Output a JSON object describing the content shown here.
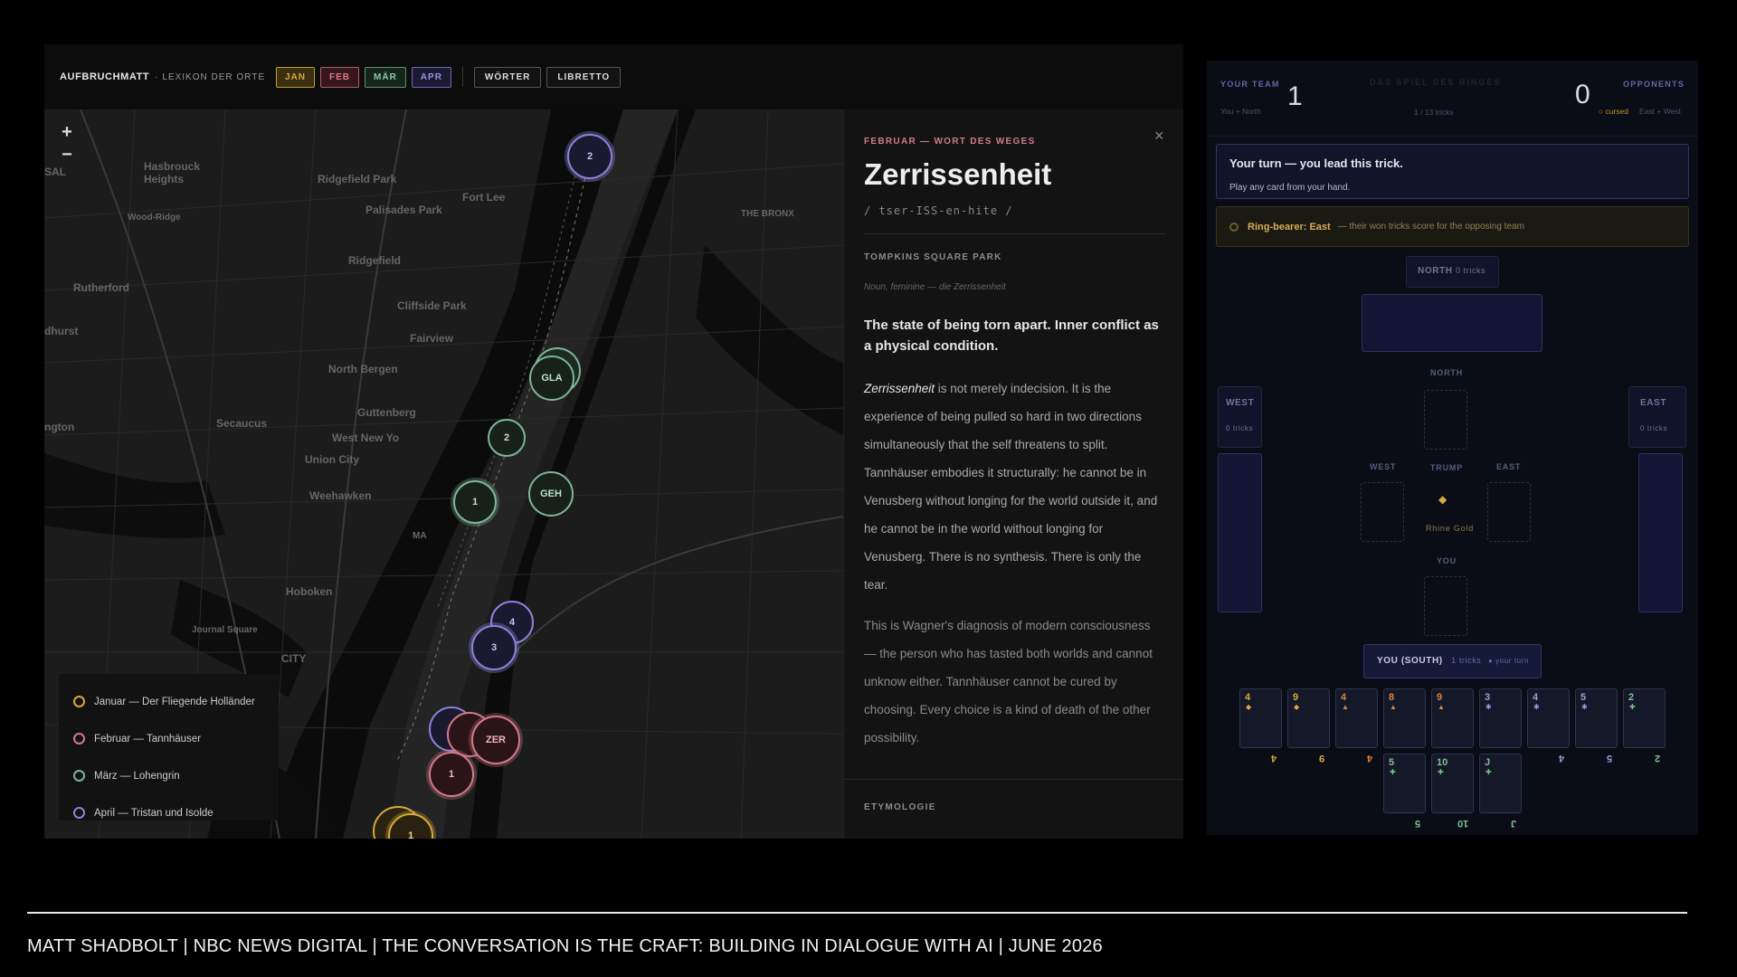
{
  "map_app": {
    "brand": "AUFBRUCHMATT",
    "brand_sub": "· LEXIKON DER ORTE",
    "months": [
      "JAN",
      "FEB",
      "MÄR",
      "APR"
    ],
    "nav": [
      "WÖRTER",
      "LIBRETTO"
    ],
    "zoom_in": "+",
    "zoom_out": "−",
    "place_labels": [
      "Hasbrouck Heights",
      "Ridgefield Park",
      "Palisades Park",
      "Fort Lee",
      "Wood-Ridge",
      "Ridgefield",
      "Rutherford",
      "Cliffside Park",
      "Fairview",
      "North Bergen",
      "Secaucus",
      "Guttenberg",
      "West New Yo",
      "Union City",
      "Weehawken",
      "Hoboken",
      "Journal Square",
      "CITY",
      "THE BRONX",
      "dhurst",
      "ngton",
      "SAL",
      "MA"
    ],
    "clusters": [
      {
        "label": "2",
        "color": "#8b84d8"
      },
      {
        "label": "GLA",
        "color": "#7fb597"
      },
      {
        "label": "2",
        "color": "#7fb597"
      },
      {
        "label": "GEH",
        "color": "#7fb597"
      },
      {
        "label": "1",
        "color": "#7fb597"
      },
      {
        "label": "4",
        "color": "#8b84d8"
      },
      {
        "label": "3",
        "color": "#8b84d8"
      },
      {
        "label": "ZER",
        "color": "#d27b88"
      },
      {
        "label": "1",
        "color": "#d27b88"
      },
      {
        "label": "1",
        "color": "#d9a93c"
      }
    ],
    "legend": [
      {
        "label": "Januar — Der Fliegende Holländer",
        "color": "#d9a93c"
      },
      {
        "label": "Februar — Tannhäuser",
        "color": "#d27b88"
      },
      {
        "label": "März — Lohengrin",
        "color": "#7fb597"
      },
      {
        "label": "April — Tristan und Isolde",
        "color": "#8b84d8"
      }
    ],
    "detail": {
      "kicker": "FEBRUAR — WORT DES WEGES",
      "title": "Zerrissenheit",
      "pronunciation": "/ tser-ISS-en-hite /",
      "place": "TOMPKINS SQUARE PARK",
      "pos": "Noun, feminine — die Zerrissenheit",
      "lead": "The state of being torn apart. Inner conflict as a physical condition.",
      "body_em": "Zerrissenheit",
      "body_rest": " is not merely indecision. It is the experience of being pulled so hard in two directions simultaneously that the self threatens to split. Tannhäuser embodies it structurally: he cannot be in Venusberg without longing for the world outside it, and he cannot be in the world without longing for Venusberg. There is no synthesis. There is only the tear.",
      "body2": "This is Wagner's diagnosis of modern consciousness — the person who has tasted both worlds and cannot unknow either. Tannhäuser cannot be cured by choosing. Every choice is a kind of death of the other possibility.",
      "etymology": "ETYMOLOGIE",
      "close": "×"
    }
  },
  "game_app": {
    "your_team": "YOUR TEAM",
    "your_team_sub": "You + North",
    "your_score": "1",
    "title": "DAS SPIEL DES RINGES",
    "trick_count": "1 / 13 tricks",
    "opp_score": "0",
    "opponents": "OPPONENTS",
    "opp_sub_cursed": "cursed",
    "opp_sub": "East + West",
    "turn_title": "Your turn — you lead this trick.",
    "turn_sub": "Play any card from your hand.",
    "ring_title": "Ring-bearer: East",
    "ring_note": "— their won tricks score for the opposing team",
    "north_tag": "NORTH",
    "north_tricks": "0 tricks",
    "north_label": "NORTH",
    "west_tag": "WEST",
    "west_tricks": "0 tricks",
    "east_tag": "EAST",
    "east_tricks": "0 tricks",
    "west_label": "WEST",
    "trump_label": "TRUMP",
    "east_label": "EAST",
    "trump_suit": "Rhine Gold",
    "you_label": "YOU",
    "you_tag": "YOU (SOUTH)",
    "you_tricks": "1 tricks",
    "your_turn_flag": "● your turn",
    "hand_row1": [
      {
        "rank": "4",
        "color": "#d9a93c",
        "suit": "◆"
      },
      {
        "rank": "9",
        "color": "#d9a93c",
        "suit": "◆"
      },
      {
        "rank": "4",
        "color": "#e0823a",
        "suit": "▲"
      },
      {
        "rank": "8",
        "color": "#e0823a",
        "suit": "▲"
      },
      {
        "rank": "9",
        "color": "#e0823a",
        "suit": "▲"
      },
      {
        "rank": "3",
        "color": "#9aa0d8",
        "suit": "✱"
      },
      {
        "rank": "4",
        "color": "#9aa0d8",
        "suit": "✱"
      },
      {
        "rank": "5",
        "color": "#9aa0d8",
        "suit": "✱"
      },
      {
        "rank": "2",
        "color": "#7fc08f",
        "suit": "✚"
      }
    ],
    "hand_row2": [
      {
        "rank": "5",
        "color": "#7fc08f",
        "suit": "✚"
      },
      {
        "rank": "10",
        "color": "#7fc08f",
        "suit": "✚"
      },
      {
        "rank": "J",
        "color": "#7fc08f",
        "suit": "✚"
      }
    ]
  },
  "footer": "MATT SHADBOLT | NBC NEWS DIGITAL | THE CONVERSATION IS THE CRAFT: BUILDING IN DIALOGUE WITH AI | JUNE 2026"
}
